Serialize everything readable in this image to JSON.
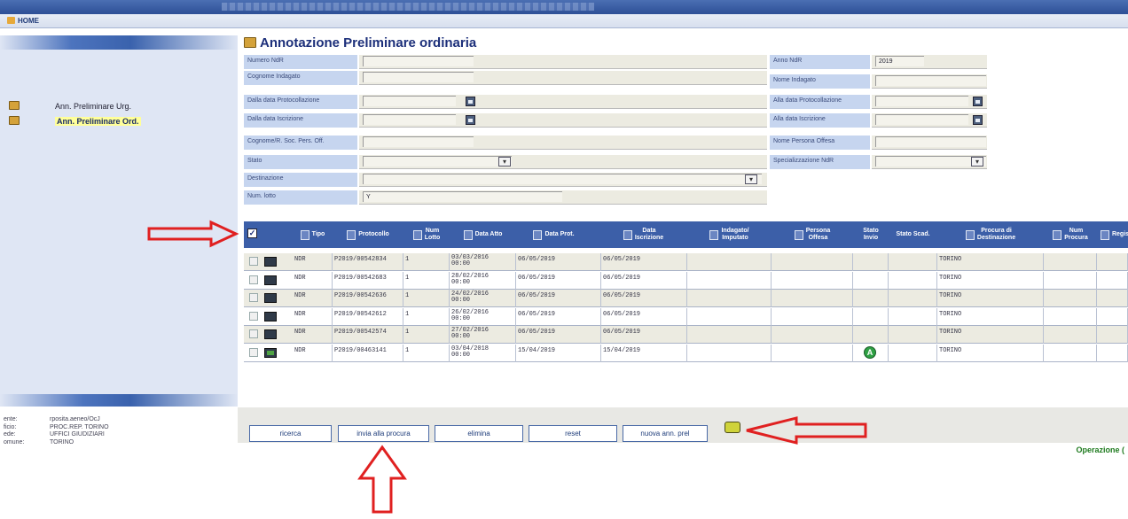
{
  "app": {
    "home_label": "HOME"
  },
  "sidebar": {
    "items": [
      {
        "label": "Ann. Preliminare Urg."
      },
      {
        "label": "Ann. Preliminare Ord."
      }
    ],
    "info": [
      {
        "key": "ente:",
        "value": "rposita.aeneo/OcJ"
      },
      {
        "key": "ficio:",
        "value": "PROC.REP. TORINO"
      },
      {
        "key": "ede:",
        "value": "UFFICI GIUDIZIARI"
      },
      {
        "key": "omune:",
        "value": "TORINO"
      }
    ]
  },
  "page": {
    "title": "Annotazione Preliminare ordinaria"
  },
  "form": {
    "numero_ndr": {
      "label": "Numero NdR",
      "value": ""
    },
    "anno_ndr": {
      "label": "Anno NdR",
      "value": "2019"
    },
    "cognome_indagato": {
      "label": "Cognome Indagato",
      "value": ""
    },
    "nome_indagato": {
      "label": "Nome Indagato",
      "value": ""
    },
    "dalla_data_protocollazione": {
      "label": "Dalla data Protocollazione",
      "value": ""
    },
    "alla_data_protocollazione": {
      "label": "Alla data Protocollazione",
      "value": ""
    },
    "dalla_data_iscrizione": {
      "label": "Dalla data Iscrizione",
      "value": ""
    },
    "alla_data_iscrizione": {
      "label": "Alla data Iscrizione",
      "value": ""
    },
    "cognome_soc": {
      "label": "Cognome/R. Soc. Pers. Off.",
      "value": ""
    },
    "nome_persona_offesa": {
      "label": "Nome Persona Offesa",
      "value": ""
    },
    "stato": {
      "label": "Stato",
      "value": ""
    },
    "specializzazione_ndr": {
      "label": "Specializzazione NdR",
      "value": ""
    },
    "destinazione": {
      "label": "Destinazione",
      "value": ""
    },
    "num_lotto": {
      "label": "Num. lotto",
      "value": "Y"
    }
  },
  "grid": {
    "headers": {
      "tipo": "Tipo",
      "protocollo": "Protocollo",
      "num_lotto": "Num\nLotto",
      "data_atto": "Data Atto",
      "data_prot": "Data Prot.",
      "data_iscrizione": "Data\nIscrizione",
      "indagato": "Indagato/\nImputato",
      "persona_offesa": "Persona\nOffesa",
      "stato_invio": "Stato\nInvio",
      "stato_scad": "Stato Scad.",
      "procura_dest": "Procura di\nDestinazione",
      "num_procura": "Num\nProcura",
      "regis": "Regis"
    },
    "rows": [
      {
        "tipo": "NDR",
        "protocollo": "P2019/00542834",
        "lotto": "1",
        "data_atto": "03/03/2016\n00:00",
        "data_prot": "06/05/2019",
        "data_iscr": "06/05/2019",
        "stato_invio": "",
        "procura": "TORINO",
        "num_procura": ""
      },
      {
        "tipo": "NDR",
        "protocollo": "P2019/00542683",
        "lotto": "1",
        "data_atto": "28/02/2016\n00:00",
        "data_prot": "06/05/2019",
        "data_iscr": "06/05/2019",
        "stato_invio": "",
        "procura": "TORINO",
        "num_procura": ""
      },
      {
        "tipo": "NDR",
        "protocollo": "P2019/00542636",
        "lotto": "1",
        "data_atto": "24/02/2016\n00:00",
        "data_prot": "06/05/2019",
        "data_iscr": "06/05/2019",
        "stato_invio": "",
        "procura": "TORINO",
        "num_procura": ""
      },
      {
        "tipo": "NDR",
        "protocollo": "P2019/00542612",
        "lotto": "1",
        "data_atto": "26/02/2016\n00:00",
        "data_prot": "06/05/2019",
        "data_iscr": "06/05/2019",
        "stato_invio": "",
        "procura": "TORINO",
        "num_procura": ""
      },
      {
        "tipo": "NDR",
        "protocollo": "P2019/00542574",
        "lotto": "1",
        "data_atto": "27/02/2016\n00:00",
        "data_prot": "06/05/2019",
        "data_iscr": "06/05/2019",
        "stato_invio": "",
        "procura": "TORINO",
        "num_procura": ""
      },
      {
        "tipo": "NDR",
        "protocollo": "P2019/00463141",
        "lotto": "1",
        "data_atto": "03/04/2018\n00:00",
        "data_prot": "15/04/2019",
        "data_iscr": "15/04/2019",
        "stato_invio": "A",
        "procura": "TORINO",
        "num_procura": ""
      }
    ]
  },
  "buttons": {
    "ricerca": "ricerca",
    "invia": "invia alla procura",
    "elimina": "elimina",
    "reset": "reset",
    "nuova": "nuova ann. prel"
  },
  "status": {
    "text": "Operazione ("
  },
  "colors": {
    "header_blue": "#3c5fa8",
    "label_blue": "#c6d5ef",
    "annotation_red": "#e02020",
    "badge_green": "#2ea043"
  }
}
